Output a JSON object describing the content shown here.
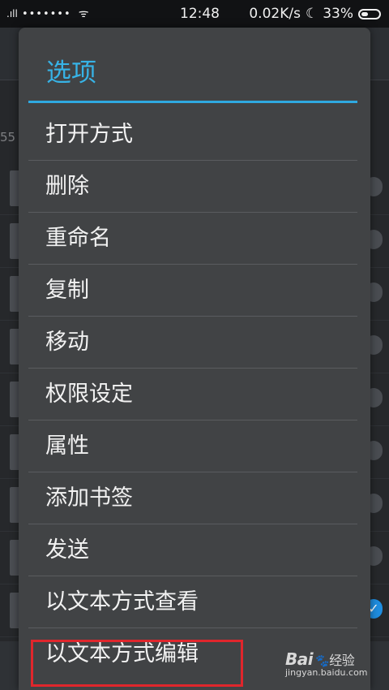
{
  "status_bar": {
    "time": "12:48",
    "network_speed": "0.02K/s",
    "battery": "33%"
  },
  "dialog": {
    "title": "选项",
    "items": [
      {
        "label": "打开方式"
      },
      {
        "label": "删除"
      },
      {
        "label": "重命名"
      },
      {
        "label": "复制"
      },
      {
        "label": "移动"
      },
      {
        "label": "权限设定"
      },
      {
        "label": "属性"
      },
      {
        "label": "添加书签"
      },
      {
        "label": "发送"
      },
      {
        "label": "以文本方式查看"
      },
      {
        "label": "以文本方式编辑"
      }
    ],
    "highlighted_item_index": 10
  },
  "background": {
    "path_fragment": "55",
    "checkmark": "✓"
  },
  "watermark": {
    "brand_left": "Bai",
    "brand_right": "经验",
    "url": "jingyan.baidu.com"
  },
  "colors": {
    "accent": "#37b3e6",
    "highlight_border": "#e0262c",
    "dialog_bg": "#414345"
  }
}
